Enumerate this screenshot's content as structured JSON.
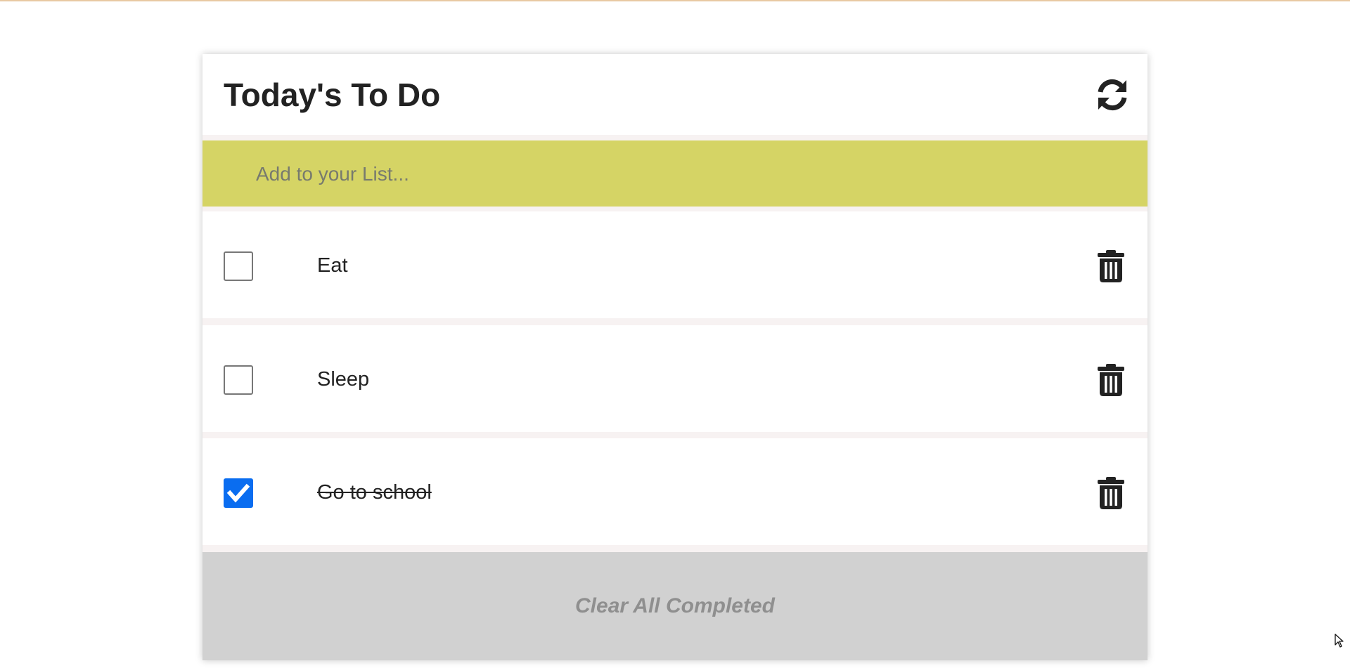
{
  "header": {
    "title": "Today's To Do",
    "refresh_icon": "refresh-icon"
  },
  "input": {
    "placeholder": "Add to your List...",
    "value": ""
  },
  "todos": [
    {
      "text": "Eat",
      "completed": false,
      "delete_icon": "trash-icon"
    },
    {
      "text": "Sleep",
      "completed": false,
      "delete_icon": "trash-icon"
    },
    {
      "text": "Go to school",
      "completed": true,
      "delete_icon": "trash-icon"
    }
  ],
  "footer": {
    "clear_label": "Clear All Completed"
  },
  "colors": {
    "input_bar": "#d5d465",
    "checkbox_checked": "#0a6df0",
    "footer": "#d1d1d1",
    "footer_text": "#8f8f8f"
  }
}
